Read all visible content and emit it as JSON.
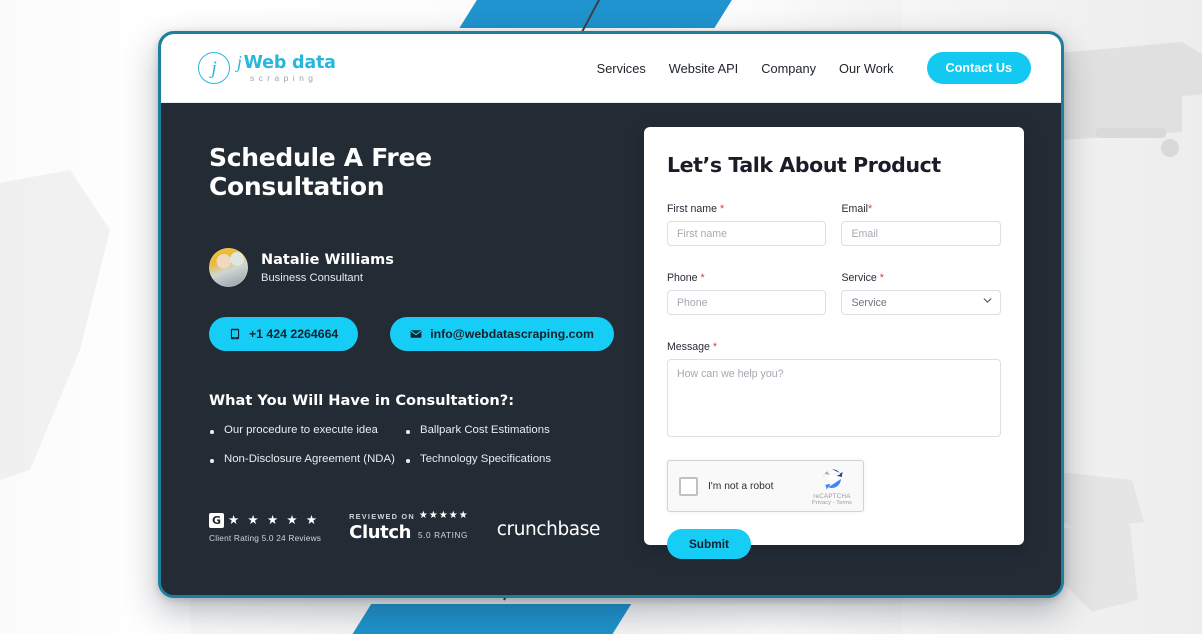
{
  "browser_mockup": {
    "header": {
      "logo": {
        "mark": "j",
        "main_prefix": "j",
        "main": "Web data",
        "sub": "scraping"
      },
      "nav_items": [
        {
          "label": "Services"
        },
        {
          "label": "Website API"
        },
        {
          "label": "Company"
        },
        {
          "label": "Our Work"
        }
      ],
      "cta_label": "Contact Us"
    },
    "left": {
      "headline": "Schedule A Free Consultation",
      "person": {
        "name": "Natalie Williams",
        "role": "Business Consultant",
        "avatar_icon": "avatar-photo"
      },
      "contacts": [
        {
          "icon": "phone-icon",
          "label": "+1 424 2264664"
        },
        {
          "icon": "envelope-icon",
          "label": "info@webdatascraping.com"
        }
      ],
      "consultation_title": "What You Will Have in Consultation?:",
      "consultation_items": [
        "Our procedure to execute idea",
        "Ballpark Cost Estimations",
        "Non-Disclosure Agreement (NDA)",
        "Technology Specifications"
      ],
      "badges": {
        "google": {
          "logo_letter": "G",
          "stars": "★ ★ ★ ★ ★",
          "caption": "Client  Rating 5.0 24 Reviews"
        },
        "clutch": {
          "reviewed_on": "REVIEWED ON",
          "stars": "★★★★★",
          "name": "Clutch",
          "rating": "5.0  RATING"
        },
        "crunchbase": {
          "name": "crunchbase"
        }
      }
    },
    "form": {
      "title": "Let’s Talk About Product",
      "fields": {
        "first_name": {
          "label": "First name",
          "required": "*",
          "placeholder": "First name",
          "value": ""
        },
        "email": {
          "label": "Email",
          "required": "*",
          "placeholder": "Email",
          "value": ""
        },
        "phone": {
          "label": "Phone",
          "required": "*",
          "placeholder": "Phone",
          "value": ""
        },
        "service": {
          "label": "Service",
          "required": "*",
          "selected": "Service"
        },
        "message": {
          "label": "Message",
          "required": "*",
          "placeholder": "How can we help you?",
          "value": ""
        }
      },
      "captcha": {
        "checkbox_label": "I'm not a robot",
        "brand": "reCAPTCHA",
        "legal": "Privacy - Terms"
      },
      "submit_label": "Submit"
    }
  },
  "colors": {
    "accent_cyan": "#16cdf5",
    "dark_panel": "#232b35",
    "frame_border": "#1b7f9e",
    "chevron_blue": "#1f94ce",
    "required_red": "#e03a3a"
  }
}
